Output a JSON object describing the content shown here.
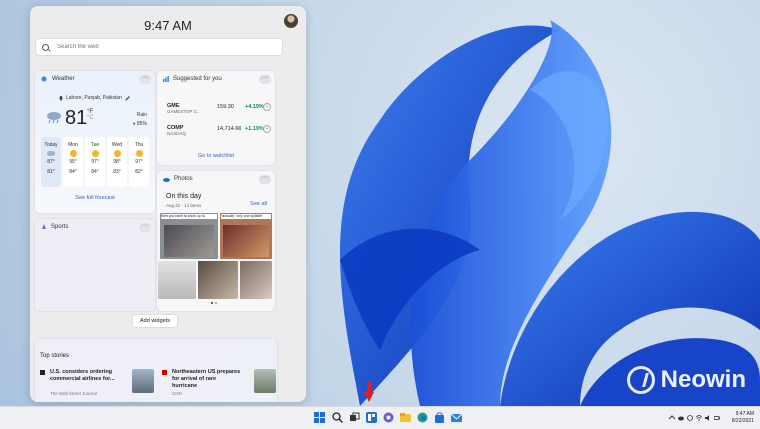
{
  "widgets": {
    "time": "9:47 AM",
    "search_placeholder": "Search the web",
    "add_widgets_label": "Add widgets"
  },
  "weather": {
    "title": "Weather",
    "location": "Lahore, Punjab, Pakistan",
    "temp": "81",
    "unit_f": "°F",
    "unit_c": "°C",
    "rain_label": "Rain",
    "rain_value": "85%",
    "days": [
      {
        "name": "Today",
        "high": "87°",
        "low": "81°"
      },
      {
        "name": "Mon",
        "high": "95°",
        "low": "84°"
      },
      {
        "name": "Tue",
        "high": "97°",
        "low": "84°"
      },
      {
        "name": "Wed",
        "high": "98°",
        "low": "83°"
      },
      {
        "name": "Thu",
        "high": "97°",
        "low": "82°"
      }
    ],
    "forecast_link": "See full forecast"
  },
  "sports": {
    "title": "Sports"
  },
  "suggested": {
    "title": "Suggested for you",
    "stocks": [
      {
        "symbol": "GME",
        "company": "GAMESTOP C...",
        "price": "159.30",
        "change": "+4.19%"
      },
      {
        "symbol": "COMP",
        "company": "NASDAQ",
        "price": "14,714.66",
        "change": "+1.19%"
      }
    ],
    "watchlist_link": "Go to watchlist"
  },
  "photos": {
    "title": "Photos",
    "subtitle": "On this day",
    "date": "Aug 22 · 14 items",
    "see_all": "See all",
    "captions": [
      "then you have to show up to",
      "\"actually\" only one syllable"
    ]
  },
  "stories": {
    "title": "Top stories",
    "items": [
      {
        "headline": "U.S. considers ordering commercial airlines for...",
        "source": "The Wall Street Journal"
      },
      {
        "headline": "Northeastern US prepares for arrival of rare hurricane",
        "source": "CNN"
      }
    ]
  },
  "watermark": "Neowin",
  "taskbar": {
    "time": "9:47 AM",
    "date": "8/22/2021"
  }
}
